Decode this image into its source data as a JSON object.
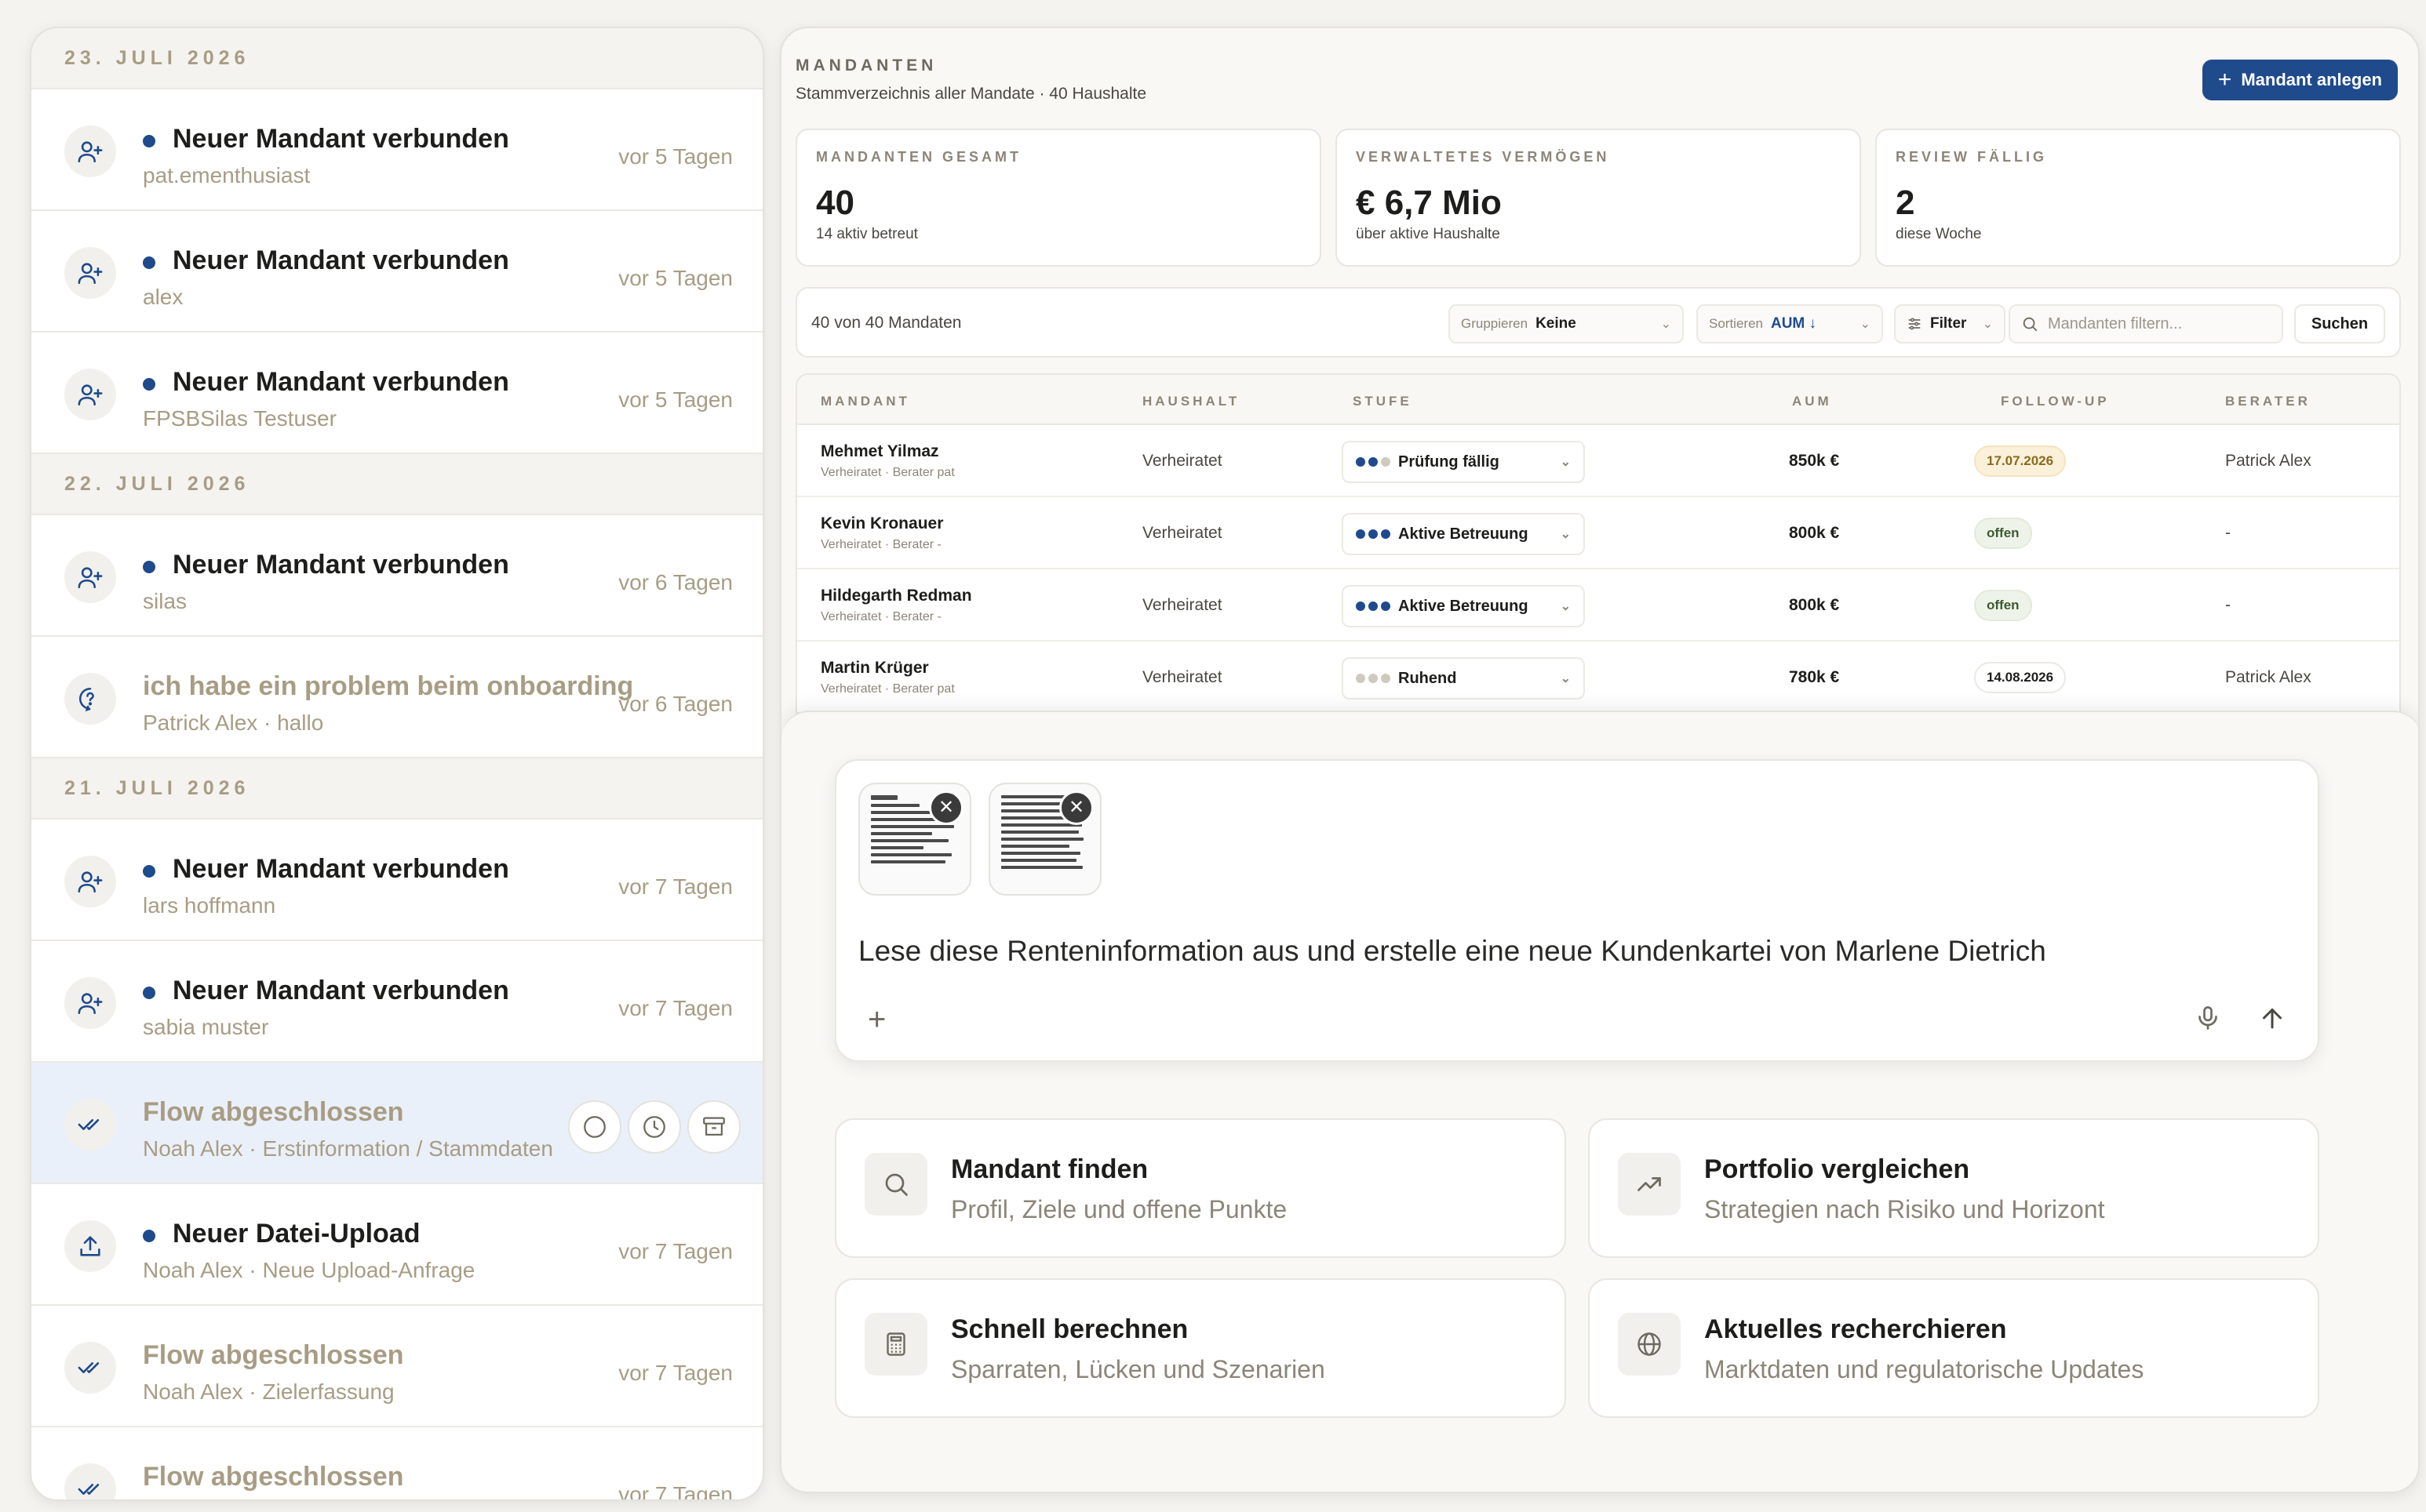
{
  "notifications": {
    "groups": [
      {
        "date": "23. JULI 2026",
        "items": [
          {
            "title": "Neuer Mandant verbunden",
            "subtitle": "pat.ementhusiast",
            "time": "vor 5 Tagen",
            "unread": true,
            "icon": "user-plus-icon"
          },
          {
            "title": "Neuer Mandant verbunden",
            "subtitle": "alex",
            "time": "vor 5 Tagen",
            "unread": true,
            "icon": "user-plus-icon"
          },
          {
            "title": "Neuer Mandant verbunden",
            "subtitle": "FPSBSilas Testuser",
            "time": "vor 5 Tagen",
            "unread": true,
            "icon": "user-plus-icon"
          }
        ]
      },
      {
        "date": "22. JULI 2026",
        "items": [
          {
            "title": "Neuer Mandant verbunden",
            "subtitle": "silas",
            "time": "vor 6 Tagen",
            "unread": true,
            "icon": "user-plus-icon"
          },
          {
            "title": "ich habe ein problem beim onboarding",
            "subtitle": "Patrick Alex · hallo",
            "time": "vor 6 Tagen",
            "unread": false,
            "icon": "help-circle-icon"
          }
        ]
      },
      {
        "date": "21. JULI 2026",
        "items": [
          {
            "title": "Neuer Mandant verbunden",
            "subtitle": "lars hoffmann",
            "time": "vor 7 Tagen",
            "unread": true,
            "icon": "user-plus-icon"
          },
          {
            "title": "Neuer Mandant verbunden",
            "subtitle": "sabia muster",
            "time": "vor 7 Tagen",
            "unread": true,
            "icon": "user-plus-icon"
          },
          {
            "title": "Flow abgeschlossen",
            "subtitle": "Noah Alex · Erstinformation / Stammdaten",
            "time": "",
            "unread": false,
            "icon": "double-check-icon",
            "highlight": true
          },
          {
            "title": "Neuer Datei-Upload",
            "subtitle": "Noah Alex · Neue Upload-Anfrage",
            "time": "vor 7 Tagen",
            "unread": true,
            "icon": "upload-icon"
          },
          {
            "title": "Flow abgeschlossen",
            "subtitle": "Noah Alex · Zielerfassung",
            "time": "vor 7 Tagen",
            "unread": false,
            "icon": "double-check-icon"
          },
          {
            "title": "Flow abgeschlossen",
            "subtitle": "",
            "time": "vor 7 Tagen",
            "unread": false,
            "icon": "double-check-icon"
          }
        ]
      }
    ]
  },
  "main": {
    "title": "MANDANTEN",
    "subtitle": "Stammverzeichnis aller Mandate · 40 Haushalte",
    "add_button": "Mandant anlegen",
    "stats": [
      {
        "label": "MANDANTEN GESAMT",
        "value": "40",
        "sub": "14 aktiv betreut"
      },
      {
        "label": "VERWALTETES VERMÖGEN",
        "value": "€ 6,7 Mio",
        "sub": "über aktive Haushalte"
      },
      {
        "label": "REVIEW FÄLLIG",
        "value": "2",
        "sub": "diese Woche"
      }
    ],
    "toolbar": {
      "count": "40 von 40 Mandaten",
      "group_label": "Gruppieren",
      "group_value": "Keine",
      "sort_label": "Sortieren",
      "sort_value": "AUM ↓",
      "filter_label": "Filter",
      "search_placeholder": "Mandanten filtern...",
      "search_button": "Suchen"
    },
    "table": {
      "columns": [
        "MANDANT",
        "HAUSHALT",
        "STUFE",
        "AUM",
        "FOLLOW-UP",
        "BERATER"
      ],
      "rows": [
        {
          "name": "Mehmet Yilmaz",
          "meta": "Verheiratet · Berater pat",
          "household": "Verheiratet",
          "stage": "Prüfung fällig",
          "stage_level": 2,
          "aum": "850k €",
          "followup": "17.07.2026",
          "followup_type": "warn",
          "advisor": "Patrick Alex"
        },
        {
          "name": "Kevin Kronauer",
          "meta": "Verheiratet · Berater -",
          "household": "Verheiratet",
          "stage": "Aktive Betreuung",
          "stage_level": 3,
          "aum": "800k €",
          "followup": "offen",
          "followup_type": "open",
          "advisor": "-"
        },
        {
          "name": "Hildegarth Redman",
          "meta": "Verheiratet · Berater -",
          "household": "Verheiratet",
          "stage": "Aktive Betreuung",
          "stage_level": 3,
          "aum": "800k €",
          "followup": "offen",
          "followup_type": "open",
          "advisor": "-"
        },
        {
          "name": "Martin Krüger",
          "meta": "Verheiratet · Berater pat",
          "household": "Verheiratet",
          "stage": "Ruhend",
          "stage_level": 0,
          "aum": "780k €",
          "followup": "14.08.2026",
          "followup_type": "date",
          "advisor": "Patrick Alex"
        }
      ]
    }
  },
  "chat": {
    "prompt": "Lese diese Renteninformation aus und erstelle eine neue Kundenkartei von Marlene Dietrich",
    "attachments": 2,
    "suggestions": [
      {
        "title": "Mandant finden",
        "desc": "Profil, Ziele und offene Punkte",
        "icon": "search-icon"
      },
      {
        "title": "Portfolio vergleichen",
        "desc": "Strategien nach Risiko und Horizont",
        "icon": "trending-up-icon"
      },
      {
        "title": "Schnell berechnen",
        "desc": "Sparraten, Lücken und Szenarien",
        "icon": "calculator-icon"
      },
      {
        "title": "Aktuelles recherchieren",
        "desc": "Marktdaten und regulatorische Updates",
        "icon": "globe-icon"
      }
    ]
  },
  "colors": {
    "accent": "#1f4a8c",
    "muted": "#a89c84",
    "background": "#f4f3ef"
  }
}
